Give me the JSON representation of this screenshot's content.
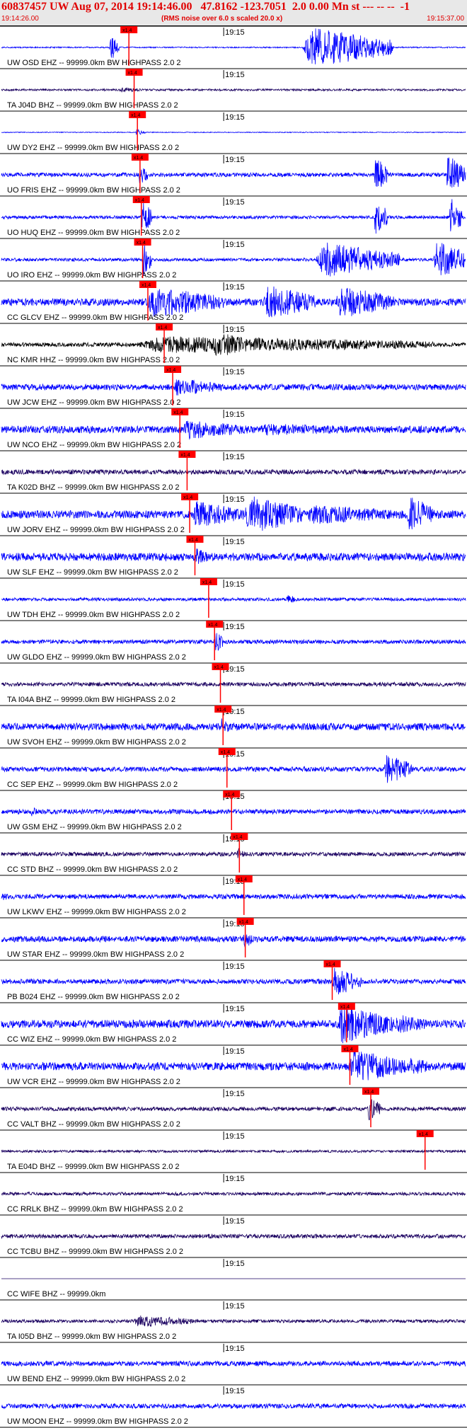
{
  "header": {
    "title": "60837457 UW Aug 07, 2014 19:14:46.00   47.8162 -123.7051  2.0 0.00 Mn st --- -- --  -1",
    "subtitle": "(RMS noise over 6.0 s scaled 20.0 x)",
    "start_time": "19:14:26.00",
    "end_time": "19:15:37.00"
  },
  "chart_data": {
    "type": "line",
    "title": "60837457 UW Aug 07, 2014 19:14:46.00   47.8162 -123.7051  2.0 0.00 Mn st --- -- --  -1",
    "subtitle": "(RMS noise over 6.0 s scaled 20.0 x)",
    "x_range": [
      "19:14:26.00",
      "19:15:37.00"
    ],
    "x_tick_label": "19:15",
    "pick_label": "x1.4",
    "colors": {
      "blue": "#0000ff",
      "black": "#000000",
      "navy": "#1a0060",
      "pick": "#ff0000",
      "header_text": "#e00000"
    },
    "traces": [
      {
        "label": "UW OSD EHZ -- 99999.0km BW  HIGHPASS  2.0  2",
        "color": "#0000ff",
        "pick_t": 19.5,
        "noise": 0.03,
        "seed": 1,
        "bursts": [
          [
            46,
            60,
            1.0
          ],
          [
            16.5,
            18,
            0.7
          ]
        ]
      },
      {
        "label": "TA J04D BHZ -- 99999.0km BW  HIGHPASS  2.0  2",
        "color": "#1a0060",
        "pick_t": 20.3,
        "noise": 0.05,
        "seed": 2,
        "bursts": [
          [
            18,
            22,
            0.12
          ]
        ]
      },
      {
        "label": "UW DY2 EHZ -- 99999.0km BW  HIGHPASS  2.0  2",
        "color": "#0000ff",
        "pick_t": 20.8,
        "noise": 0.02,
        "seed": 3,
        "bursts": [
          [
            20.5,
            22,
            0.15
          ]
        ]
      },
      {
        "label": "UO FRIS EHZ -- 99999.0km BW  HIGHPASS  2.0  2",
        "color": "#0000ff",
        "pick_t": 21.2,
        "noise": 0.1,
        "seed": 4,
        "bursts": [
          [
            21,
            22.5,
            0.6
          ],
          [
            57,
            59,
            1.0
          ],
          [
            68,
            71,
            1.0
          ]
        ]
      },
      {
        "label": "UO HUQ EHZ -- 99999.0km BW  HIGHPASS  2.0  2",
        "color": "#0000ff",
        "pick_t": 21.4,
        "noise": 0.08,
        "seed": 5,
        "bursts": [
          [
            21.3,
            23,
            0.9
          ],
          [
            57,
            59,
            1.0
          ],
          [
            68.5,
            70.5,
            1.0
          ]
        ]
      },
      {
        "label": "UO IRO EHZ -- 99999.0km BW  HIGHPASS  2.0  2",
        "color": "#0000ff",
        "pick_t": 21.6,
        "noise": 0.08,
        "seed": 6,
        "bursts": [
          [
            21.5,
            23,
            0.9
          ],
          [
            48,
            61,
            0.9
          ],
          [
            66,
            71,
            1.0
          ]
        ]
      },
      {
        "label": "CC GLCV EHZ -- 99999.0km BW  HIGHPASS  2.0  2",
        "color": "#0000ff",
        "pick_t": 22.4,
        "noise": 0.18,
        "seed": 7,
        "bursts": [
          [
            22,
            34,
            0.8
          ],
          [
            40,
            48,
            0.9
          ],
          [
            51,
            60,
            0.85
          ]
        ]
      },
      {
        "label": "NC KMR HHZ -- 99999.0km BW  HIGHPASS  2.0  2",
        "color": "#000000",
        "pick_t": 24.9,
        "noise": 0.1,
        "seed": 8,
        "bursts": [
          [
            20,
            66,
            0.45
          ],
          [
            32,
            39,
            0.65
          ]
        ]
      },
      {
        "label": "UW JCW EHZ -- 99999.0km BW  HIGHPASS  2.0  2",
        "color": "#0000ff",
        "pick_t": 26.2,
        "noise": 0.15,
        "seed": 9,
        "bursts": [
          [
            26,
            34,
            0.45
          ]
        ]
      },
      {
        "label": "UW NCO EHZ -- 99999.0km BW  HIGHPASS  2.0  2",
        "color": "#0000ff",
        "pick_t": 27.3,
        "noise": 0.18,
        "seed": 10,
        "bursts": [
          [
            27.2,
            38,
            0.5
          ],
          [
            38,
            62,
            0.3
          ]
        ]
      },
      {
        "label": "TA K02D BHZ -- 99999.0km BW  HIGHPASS  2.0  2",
        "color": "#1a0060",
        "pick_t": 28.4,
        "noise": 0.12,
        "seed": 11,
        "bursts": []
      },
      {
        "label": "UW JORV EHZ -- 99999.0km BW  HIGHPASS  2.0  2",
        "color": "#0000ff",
        "pick_t": 28.8,
        "noise": 0.2,
        "seed": 12,
        "bursts": [
          [
            29,
            37,
            0.7
          ],
          [
            37,
            46,
            1.0
          ],
          [
            46,
            62,
            0.5
          ],
          [
            62,
            66,
            1.0
          ]
        ]
      },
      {
        "label": "UW SLF EHZ -- 99999.0km BW  HIGHPASS  2.0  2",
        "color": "#0000ff",
        "pick_t": 29.6,
        "noise": 0.2,
        "seed": 13,
        "bursts": [
          [
            29.5,
            32,
            0.45
          ]
        ]
      },
      {
        "label": "UW TDH EHZ -- 99999.0km BW  HIGHPASS  2.0  2",
        "color": "#0000ff",
        "pick_t": 31.7,
        "noise": 0.08,
        "seed": 14,
        "bursts": [
          [
            43.5,
            45,
            0.3
          ]
        ]
      },
      {
        "label": "UW GLDO EHZ -- 99999.0km BW  HIGHPASS  2.0  2",
        "color": "#0000ff",
        "pick_t": 32.6,
        "noise": 0.1,
        "seed": 15,
        "bursts": [
          [
            32.5,
            34,
            0.6
          ]
        ]
      },
      {
        "label": "TA I04A BHZ -- 99999.0km BW  HIGHPASS  2.0  2",
        "color": "#1a0060",
        "pick_t": 33.5,
        "noise": 0.1,
        "seed": 16,
        "bursts": []
      },
      {
        "label": "UW SVOH EHZ -- 99999.0km BW  HIGHPASS  2.0  2",
        "color": "#0000ff",
        "pick_t": 33.9,
        "noise": 0.18,
        "seed": 17,
        "bursts": [
          [
            33.5,
            35,
            0.5
          ]
        ]
      },
      {
        "label": "CC SEP EHZ -- 99999.0km BW  HIGHPASS  2.0  2",
        "color": "#0000ff",
        "pick_t": 34.5,
        "noise": 0.12,
        "seed": 18,
        "bursts": [
          [
            58.5,
            63,
            0.75
          ]
        ]
      },
      {
        "label": "UW GSM EHZ -- 99999.0km BW  HIGHPASS  2.0  2",
        "color": "#0000ff",
        "pick_t": 35.2,
        "noise": 0.12,
        "seed": 19,
        "bursts": [
          [
            4.5,
            5.5,
            0.3
          ]
        ]
      },
      {
        "label": "CC STD BHZ -- 99999.0km BW  HIGHPASS  2.0  2",
        "color": "#1a0060",
        "pick_t": 36.4,
        "noise": 0.1,
        "seed": 20,
        "bursts": [
          [
            36,
            37.5,
            0.35
          ]
        ]
      },
      {
        "label": "UW LKWV EHZ -- 99999.0km BW  HIGHPASS  2.0  2",
        "color": "#0000ff",
        "pick_t": 37.1,
        "noise": 0.12,
        "seed": 21,
        "bursts": [
          [
            0,
            2,
            0.2
          ]
        ]
      },
      {
        "label": "UW STAR EHZ -- 99999.0km BW  HIGHPASS  2.0  2",
        "color": "#0000ff",
        "pick_t": 37.3,
        "noise": 0.15,
        "seed": 22,
        "bursts": [
          [
            37,
            38.5,
            0.5
          ]
        ]
      },
      {
        "label": "PB B024 EHZ -- 99999.0km BW  HIGHPASS  2.0  2",
        "color": "#0000ff",
        "pick_t": 50.6,
        "noise": 0.12,
        "seed": 23,
        "bursts": [
          [
            50.5,
            55,
            0.75
          ]
        ]
      },
      {
        "label": "CC WIZ EHZ -- 99999.0km BW  HIGHPASS  2.0  2",
        "color": "#0000ff",
        "pick_t": 52.8,
        "noise": 0.2,
        "seed": 24,
        "bursts": [
          [
            51,
            60,
            1.0
          ],
          [
            60,
            66,
            0.5
          ]
        ]
      },
      {
        "label": "UW VCR EHZ -- 99999.0km BW  HIGHPASS  2.0  2",
        "color": "#0000ff",
        "pick_t": 53.3,
        "noise": 0.2,
        "seed": 25,
        "bursts": [
          [
            53,
            62,
            0.85
          ],
          [
            62,
            66,
            0.5
          ]
        ]
      },
      {
        "label": "CC VALT BHZ -- 99999.0km BW  HIGHPASS  2.0  2",
        "color": "#1a0060",
        "pick_t": 56.5,
        "noise": 0.1,
        "seed": 26,
        "bursts": [
          [
            56,
            58,
            0.65
          ]
        ]
      },
      {
        "label": "TA E04D BHZ -- 99999.0km BW  HIGHPASS  2.0  2",
        "color": "#1a0060",
        "pick_t": 64.8,
        "noise": 0.06,
        "seed": 27,
        "bursts": []
      },
      {
        "label": "CC RRLK BHZ -- 99999.0km BW  HIGHPASS  2.0  2",
        "color": "#1a0060",
        "pick_t": null,
        "noise": 0.08,
        "seed": 28,
        "bursts": []
      },
      {
        "label": "CC TCBU BHZ -- 99999.0km BW  HIGHPASS  2.0  2",
        "color": "#1a0060",
        "pick_t": null,
        "noise": 0.1,
        "seed": 29,
        "bursts": []
      },
      {
        "label": "CC WIFE BHZ -- 99999.0km",
        "color": "#1a0060",
        "pick_t": null,
        "noise": 0.0,
        "seed": 30,
        "bursts": []
      },
      {
        "label": "TA I05D BHZ -- 99999.0km BW  HIGHPASS  2.0  2",
        "color": "#1a0060",
        "pick_t": null,
        "noise": 0.08,
        "seed": 31,
        "bursts": [
          [
            20,
            30,
            0.3
          ]
        ]
      },
      {
        "label": "UW BEND EHZ -- 99999.0km BW  HIGHPASS  2.0  2",
        "color": "#0000ff",
        "pick_t": null,
        "noise": 0.12,
        "seed": 32,
        "bursts": []
      },
      {
        "label": "UW MOON EHZ -- 99999.0km BW  HIGHPASS  2.0  2",
        "color": "#0000ff",
        "pick_t": null,
        "noise": 0.12,
        "seed": 33,
        "bursts": []
      }
    ]
  }
}
